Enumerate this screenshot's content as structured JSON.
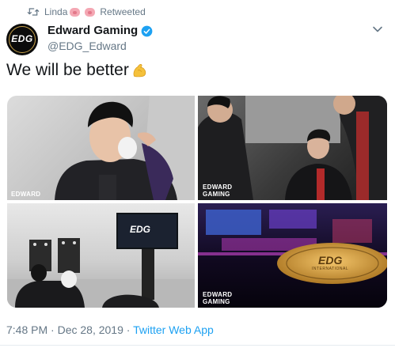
{
  "retweet": {
    "user": "Linda",
    "label": "Retweeted"
  },
  "author": {
    "name": "Edward Gaming",
    "handle": "@EDG_Edward",
    "avatar_text": "EDG"
  },
  "tweet": {
    "text": "We will be better"
  },
  "media": {
    "watermark_1": "EDWARD",
    "watermark_2": "EDWARD\nGAMING",
    "watermark_4": "EDWARD\nGAMING",
    "tv_logo": "EDG",
    "stage_logo": "EDG",
    "stage_sub": "INTERNATIONAL"
  },
  "footer": {
    "time": "7:48 PM",
    "date": "Dec 28, 2019",
    "separator": "·",
    "source": "Twitter Web App"
  },
  "colors": {
    "link": "#1da1f2",
    "muted": "#657786",
    "text": "#14171a",
    "gold": "#c8962e"
  }
}
